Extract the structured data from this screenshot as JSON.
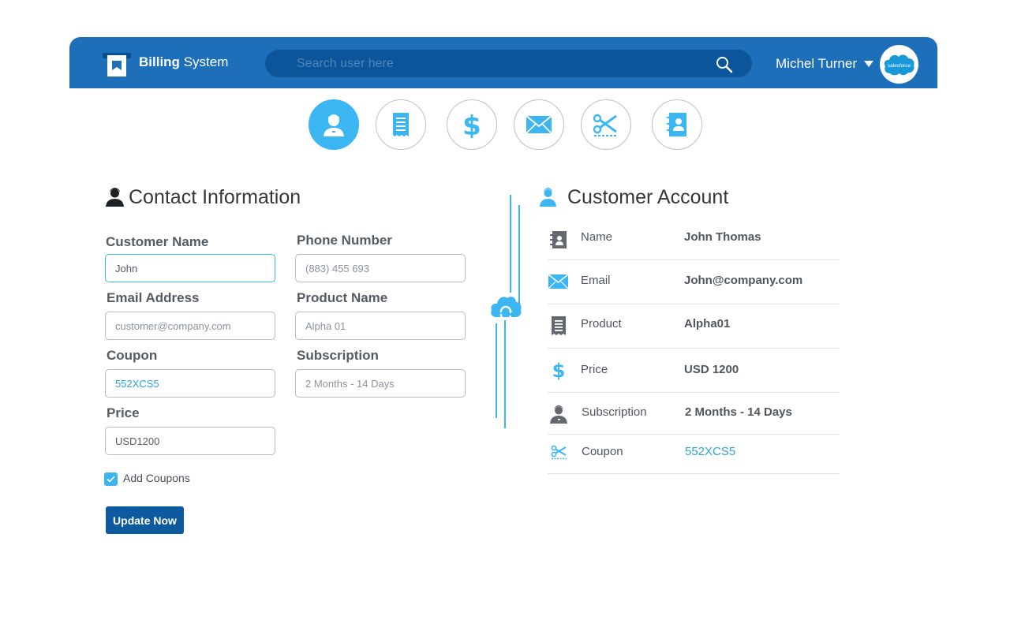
{
  "header": {
    "brand_bold": "Billing",
    "brand_light": "System",
    "search_placeholder": "Search user here",
    "user_name": "Michel Turner",
    "avatar_brand": "salesforce"
  },
  "nav": [
    {
      "icon": "user-icon",
      "active": true
    },
    {
      "icon": "receipt-icon",
      "active": false
    },
    {
      "icon": "dollar-icon",
      "active": false
    },
    {
      "icon": "mail-icon",
      "active": false
    },
    {
      "icon": "scissors-icon",
      "active": false
    },
    {
      "icon": "contact-book-icon",
      "active": false
    }
  ],
  "contact": {
    "title": "Contact Information",
    "fields": {
      "customer_name": {
        "label": "Customer Name",
        "value": "John"
      },
      "phone_number": {
        "label": "Phone Number",
        "placeholder": "(883) 455 693"
      },
      "email_address": {
        "label": "Email Address",
        "placeholder": "customer@company.com"
      },
      "product_name": {
        "label": "Product Name",
        "placeholder": "Alpha 01"
      },
      "coupon": {
        "label": "Coupon",
        "value": "552XCS5"
      },
      "subscription": {
        "label": "Subscription",
        "placeholder": "2 Months - 14 Days"
      },
      "price": {
        "label": "Price",
        "value": "USD1200"
      }
    },
    "add_coupons_label": "Add Coupons",
    "add_coupons_checked": true,
    "update_button": "Update Now"
  },
  "account": {
    "title": "Customer Account",
    "rows": [
      {
        "icon": "contact-book-icon",
        "label": "Name",
        "value": "John Thomas"
      },
      {
        "icon": "mail-icon",
        "label": "Email",
        "value": "John@company.com"
      },
      {
        "icon": "receipt-icon",
        "label": "Product",
        "value": "Alpha01"
      },
      {
        "icon": "dollar-icon",
        "label": "Price",
        "value": "USD 1200"
      },
      {
        "icon": "user-icon",
        "label": "Subscription",
        "value": "2 Months - 14 Days"
      },
      {
        "icon": "scissors-icon",
        "label": "Coupon",
        "value": "552XCS5"
      }
    ]
  },
  "colors": {
    "header": "#1e6fb9",
    "search_bg": "#0c559b",
    "accent": "#3cb6f2",
    "button": "#0e5a9e"
  }
}
